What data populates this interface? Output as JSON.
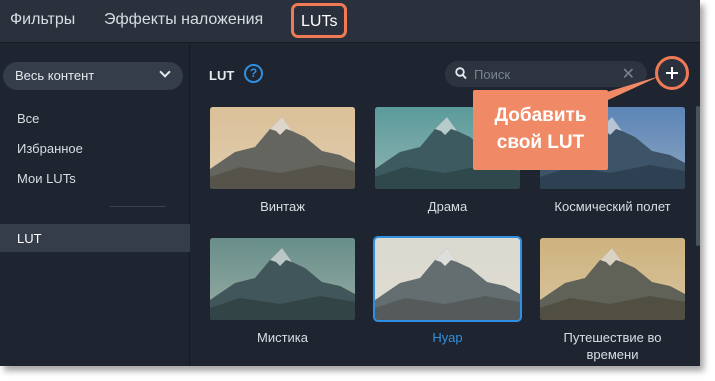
{
  "tabs": [
    {
      "label": "Фильтры"
    },
    {
      "label": "Эффекты наложения"
    },
    {
      "label": "LUTs"
    }
  ],
  "sidebar": {
    "dropdown_label": "Весь контент",
    "items": [
      {
        "label": "Все"
      },
      {
        "label": "Избранное"
      },
      {
        "label": "Мои LUTs"
      }
    ],
    "active_item": "LUT"
  },
  "main": {
    "section_title": "LUT",
    "help_glyph": "?",
    "search": {
      "placeholder": "Поиск",
      "value": ""
    },
    "add_button_icon": "plus-icon",
    "selected_card": "Нуар"
  },
  "cards": [
    {
      "label": "Винтаж",
      "tint": "#d9b98a"
    },
    {
      "label": "Драма",
      "tint": "#3a8a8e"
    },
    {
      "label": "Космический полет",
      "tint": "#3a6fb0"
    },
    {
      "label": "Мистика",
      "tint": "#4a7a78"
    },
    {
      "label": "Нуар",
      "tint": "#d8d8d0"
    },
    {
      "label": "Путешествие во времени",
      "tint": "#c9a86a"
    }
  ],
  "callout": {
    "line1": "Добавить",
    "line2": "свой LUT",
    "color": "#f08a66"
  },
  "colors": {
    "accent": "#2f8fe0",
    "highlight": "#f07a55",
    "background": "#1f2530"
  }
}
